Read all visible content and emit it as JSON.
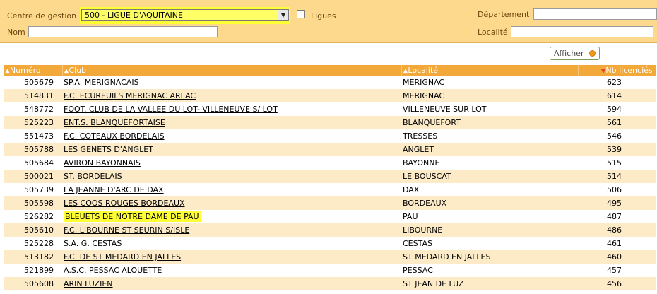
{
  "filters": {
    "centre_label": "Centre de gestion",
    "centre_value": "500 - LIGUE D'AQUITAINE",
    "ligues_label": "Ligues",
    "nom_label": "Nom",
    "nom_value": "",
    "departement_label": "Département",
    "departement_value": "",
    "localite_label": "Localité",
    "localite_value": "",
    "afficher_label": "Afficher"
  },
  "table": {
    "headers": [
      "Numéro",
      "Club",
      "Localité",
      "Nb licenciés"
    ],
    "rows": [
      {
        "numero": "505679",
        "club": "SP.A. MERIGNACAIS",
        "localite": "MERIGNAC",
        "nb": "623"
      },
      {
        "numero": "514831",
        "club": "F.C. ECUREUILS MERIGNAC ARLAC",
        "localite": "MERIGNAC",
        "nb": "614"
      },
      {
        "numero": "548772",
        "club": "FOOT. CLUB DE LA VALLEE DU LOT- VILLENEUVE S/ LOT",
        "localite": "VILLENEUVE SUR LOT",
        "nb": "594"
      },
      {
        "numero": "525223",
        "club": "ENT.S. BLANQUEFORTAISE",
        "localite": "BLANQUEFORT",
        "nb": "561"
      },
      {
        "numero": "551473",
        "club": "F.C. COTEAUX BORDELAIS",
        "localite": "TRESSES",
        "nb": "546"
      },
      {
        "numero": "505788",
        "club": "LES GENETS D'ANGLET",
        "localite": "ANGLET",
        "nb": "539"
      },
      {
        "numero": "505684",
        "club": "AVIRON BAYONNAIS",
        "localite": "BAYONNE",
        "nb": "515"
      },
      {
        "numero": "500021",
        "club": "ST. BORDELAIS",
        "localite": "LE BOUSCAT",
        "nb": "514"
      },
      {
        "numero": "505739",
        "club": "LA JEANNE D'ARC DE DAX",
        "localite": "DAX",
        "nb": "506"
      },
      {
        "numero": "505598",
        "club": "LES COQS ROUGES BORDEAUX",
        "localite": "BORDEAUX",
        "nb": "495"
      },
      {
        "numero": "526282",
        "club": "BLEUETS DE NOTRE DAME DE PAU",
        "localite": "PAU",
        "nb": "487"
      },
      {
        "numero": "505610",
        "club": "F.C. LIBOURNE ST SEURIN S/ISLE",
        "localite": "LIBOURNE",
        "nb": "486"
      },
      {
        "numero": "525228",
        "club": "S.A. G. CESTAS",
        "localite": "CESTAS",
        "nb": "461"
      },
      {
        "numero": "513182",
        "club": "F.C. DE ST MEDARD EN JALLES",
        "localite": "ST MEDARD EN JALLES",
        "nb": "460"
      },
      {
        "numero": "521899",
        "club": "A.S.C. PESSAC ALOUETTE",
        "localite": "PESSAC",
        "nb": "457"
      },
      {
        "numero": "505608",
        "club": "ARIN LUZIEN",
        "localite": "ST JEAN DE LUZ",
        "nb": "456"
      }
    ]
  },
  "colors": {
    "panel": "#fcd98c",
    "header": "#f2a93a",
    "row_alt": "#fdebc8",
    "highlight": "#ffff33",
    "sort_active": "#e8461b"
  }
}
